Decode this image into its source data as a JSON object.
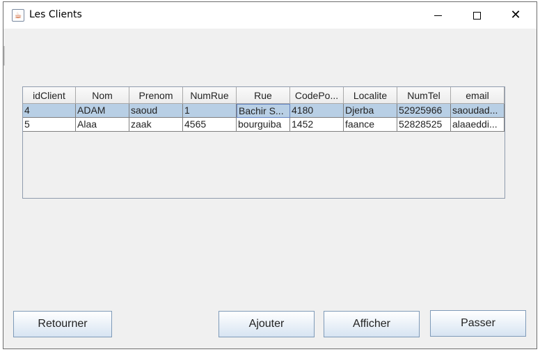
{
  "window": {
    "title": "Les Clients",
    "icon": "java-coffee-icon",
    "controls": {
      "minimize": "minimize-icon",
      "maximize": "maximize-icon",
      "close": "close-icon"
    }
  },
  "table": {
    "columns": [
      "idClient",
      "Nom",
      "Prenom",
      "NumRue",
      "Rue",
      "CodePo...",
      "Localite",
      "NumTel",
      "email"
    ],
    "rows": [
      [
        "4",
        "ADAM",
        "saoud",
        "1",
        "Bachir S...",
        "4180",
        "Djerba",
        "52925966",
        "saoudad..."
      ],
      [
        "5",
        "Alaa",
        "zaak",
        "4565",
        "bourguiba",
        "1452",
        "faance",
        "52828525",
        "alaaeddi..."
      ]
    ],
    "selected_row": 0,
    "selection_color": "#b8cfe5"
  },
  "buttons": {
    "retourner": "Retourner",
    "ajouter": "Ajouter",
    "afficher": "Afficher",
    "passer": "Passer"
  }
}
